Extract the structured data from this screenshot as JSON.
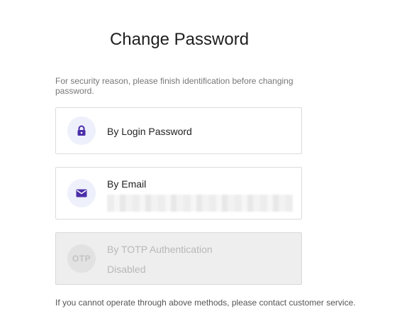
{
  "page": {
    "title": "Change Password",
    "description": "For security reason, please finish identification before changing password.",
    "footer": "If you cannot operate through above methods, please contact customer service."
  },
  "methods": [
    {
      "label": "By Login Password",
      "icon": "lock-icon",
      "enabled": true
    },
    {
      "label": "By Email",
      "icon": "mail-icon",
      "enabled": true
    },
    {
      "label": "By TOTP Authentication",
      "icon_text": "OTP",
      "status": "Disabled",
      "enabled": false
    }
  ],
  "colors": {
    "accent": "#4b2ea8",
    "icon_bg": "#eef0fb",
    "disabled_bg": "#eeeeee"
  }
}
